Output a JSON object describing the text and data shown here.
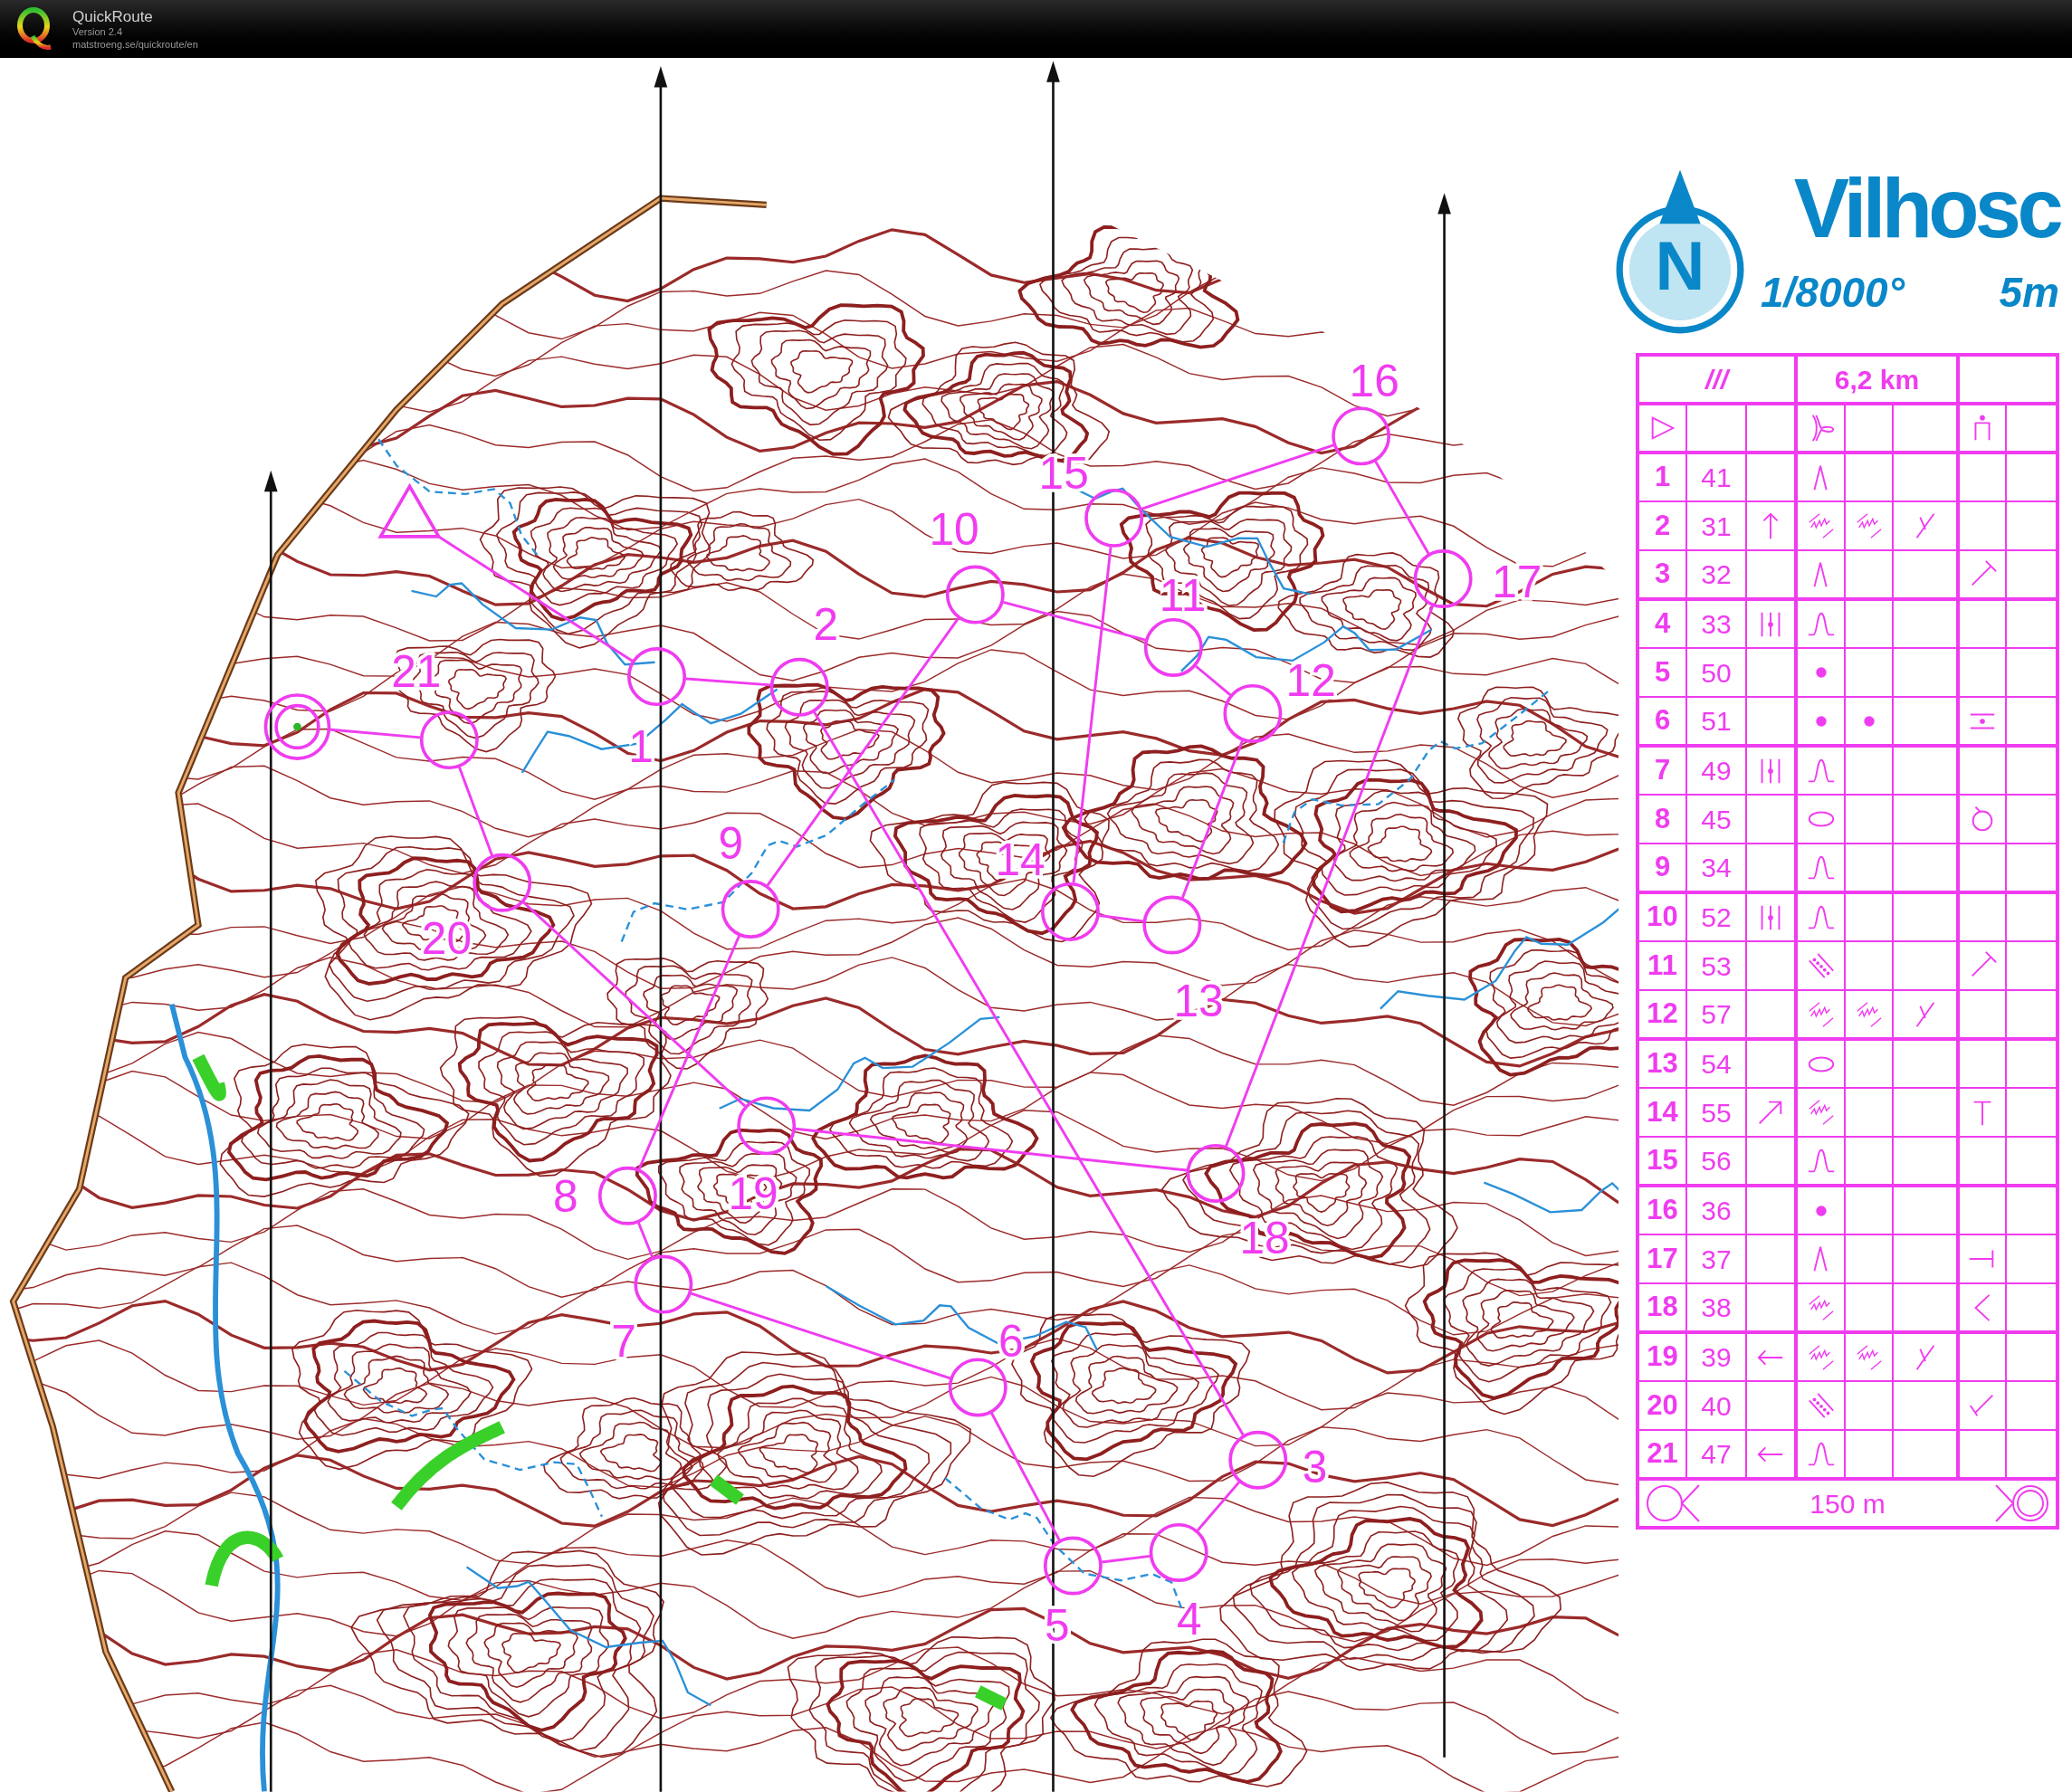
{
  "window": {
    "app_name": "QuickRoute",
    "version": "Version 2.4",
    "url": "matstroeng.se/quickroute/en"
  },
  "map": {
    "north_label": "N",
    "title": "Vilhosc",
    "scale": "1/8000°",
    "contour_interval": "5m",
    "controls": [
      {
        "label": "1"
      },
      {
        "label": "2"
      },
      {
        "label": "3"
      },
      {
        "label": "4"
      },
      {
        "label": "5"
      },
      {
        "label": "6"
      },
      {
        "label": "7"
      },
      {
        "label": "8"
      },
      {
        "label": "9"
      },
      {
        "label": "10"
      },
      {
        "label": "11"
      },
      {
        "label": "12"
      },
      {
        "label": "13"
      },
      {
        "label": "14"
      },
      {
        "label": "15"
      },
      {
        "label": "16"
      },
      {
        "label": "17"
      },
      {
        "label": "18"
      },
      {
        "label": "19"
      },
      {
        "label": "20"
      },
      {
        "label": "21"
      }
    ]
  },
  "descriptions": {
    "header": {
      "class": "///",
      "length": "6,2 km"
    },
    "start_row": [
      {
        "kind": "triangle"
      },
      {
        "kind": "blank"
      },
      {
        "kind": "blank"
      },
      {
        "kind": "fork-end"
      },
      {
        "kind": "blank"
      },
      {
        "kind": "blank"
      },
      {
        "kind": "person"
      },
      {
        "kind": "blank"
      }
    ],
    "rows": [
      {
        "number": "1",
        "code": "41",
        "cells": [
          {
            "kind": "blank"
          },
          {
            "kind": "caret"
          },
          {
            "kind": "blank"
          },
          {
            "kind": "blank"
          },
          {
            "kind": "blank"
          },
          {
            "kind": "blank"
          }
        ]
      },
      {
        "number": "2",
        "code": "31",
        "cells": [
          {
            "kind": "arrow-up"
          },
          {
            "kind": "zigzag"
          },
          {
            "kind": "zigzag"
          },
          {
            "kind": "y-junction"
          },
          {
            "kind": "blank"
          },
          {
            "kind": "blank"
          }
        ]
      },
      {
        "number": "3",
        "code": "32",
        "cells": [
          {
            "kind": "blank"
          },
          {
            "kind": "caret"
          },
          {
            "kind": "blank"
          },
          {
            "kind": "blank"
          },
          {
            "kind": "foot-tick"
          },
          {
            "kind": "blank"
          }
        ]
      },
      {
        "number": "4",
        "code": "33",
        "cells": [
          {
            "kind": "between"
          },
          {
            "kind": "hill"
          },
          {
            "kind": "blank"
          },
          {
            "kind": "blank"
          },
          {
            "kind": "blank"
          },
          {
            "kind": "blank"
          }
        ]
      },
      {
        "number": "5",
        "code": "50",
        "cells": [
          {
            "kind": "blank"
          },
          {
            "kind": "dot"
          },
          {
            "kind": "blank"
          },
          {
            "kind": "blank"
          },
          {
            "kind": "blank"
          },
          {
            "kind": "blank"
          }
        ]
      },
      {
        "number": "6",
        "code": "51",
        "cells": [
          {
            "kind": "blank"
          },
          {
            "kind": "dot"
          },
          {
            "kind": "dot"
          },
          {
            "kind": "blank"
          },
          {
            "kind": "between-lines"
          },
          {
            "kind": "blank"
          }
        ]
      },
      {
        "number": "7",
        "code": "49",
        "cells": [
          {
            "kind": "between"
          },
          {
            "kind": "hill"
          },
          {
            "kind": "blank"
          },
          {
            "kind": "blank"
          },
          {
            "kind": "blank"
          },
          {
            "kind": "blank"
          }
        ]
      },
      {
        "number": "8",
        "code": "45",
        "cells": [
          {
            "kind": "blank"
          },
          {
            "kind": "ellipse"
          },
          {
            "kind": "blank"
          },
          {
            "kind": "blank"
          },
          {
            "kind": "circle-tick"
          },
          {
            "kind": "blank"
          }
        ]
      },
      {
        "number": "9",
        "code": "34",
        "cells": [
          {
            "kind": "blank"
          },
          {
            "kind": "hill"
          },
          {
            "kind": "blank"
          },
          {
            "kind": "blank"
          },
          {
            "kind": "blank"
          },
          {
            "kind": "blank"
          }
        ]
      },
      {
        "number": "10",
        "code": "52",
        "cells": [
          {
            "kind": "between"
          },
          {
            "kind": "hill"
          },
          {
            "kind": "blank"
          },
          {
            "kind": "blank"
          },
          {
            "kind": "blank"
          },
          {
            "kind": "blank"
          }
        ]
      },
      {
        "number": "11",
        "code": "53",
        "cells": [
          {
            "kind": "blank"
          },
          {
            "kind": "dotted-band"
          },
          {
            "kind": "blank"
          },
          {
            "kind": "blank"
          },
          {
            "kind": "foot-tick"
          },
          {
            "kind": "blank"
          }
        ]
      },
      {
        "number": "12",
        "code": "57",
        "cells": [
          {
            "kind": "blank"
          },
          {
            "kind": "zigzag"
          },
          {
            "kind": "zigzag"
          },
          {
            "kind": "y-junction"
          },
          {
            "kind": "blank"
          },
          {
            "kind": "blank"
          }
        ]
      },
      {
        "number": "13",
        "code": "54",
        "cells": [
          {
            "kind": "blank"
          },
          {
            "kind": "ellipse"
          },
          {
            "kind": "blank"
          },
          {
            "kind": "blank"
          },
          {
            "kind": "blank"
          },
          {
            "kind": "blank"
          }
        ]
      },
      {
        "number": "14",
        "code": "55",
        "cells": [
          {
            "kind": "arrow-up-right"
          },
          {
            "kind": "zigzag"
          },
          {
            "kind": "blank"
          },
          {
            "kind": "blank"
          },
          {
            "kind": "t-foot"
          },
          {
            "kind": "blank"
          }
        ]
      },
      {
        "number": "15",
        "code": "56",
        "cells": [
          {
            "kind": "blank"
          },
          {
            "kind": "hill"
          },
          {
            "kind": "blank"
          },
          {
            "kind": "blank"
          },
          {
            "kind": "blank"
          },
          {
            "kind": "blank"
          }
        ]
      },
      {
        "number": "16",
        "code": "36",
        "cells": [
          {
            "kind": "blank"
          },
          {
            "kind": "dot"
          },
          {
            "kind": "blank"
          },
          {
            "kind": "blank"
          },
          {
            "kind": "blank"
          },
          {
            "kind": "blank"
          }
        ]
      },
      {
        "number": "17",
        "code": "37",
        "cells": [
          {
            "kind": "blank"
          },
          {
            "kind": "caret"
          },
          {
            "kind": "blank"
          },
          {
            "kind": "blank"
          },
          {
            "kind": "side-foot"
          },
          {
            "kind": "blank"
          }
        ]
      },
      {
        "number": "18",
        "code": "38",
        "cells": [
          {
            "kind": "blank"
          },
          {
            "kind": "zigzag"
          },
          {
            "kind": "blank"
          },
          {
            "kind": "blank"
          },
          {
            "kind": "bend"
          },
          {
            "kind": "blank"
          }
        ]
      },
      {
        "number": "19",
        "code": "39",
        "cells": [
          {
            "kind": "arrow-left"
          },
          {
            "kind": "zigzag"
          },
          {
            "kind": "zigzag"
          },
          {
            "kind": "y-junction"
          },
          {
            "kind": "blank"
          },
          {
            "kind": "blank"
          }
        ]
      },
      {
        "number": "20",
        "code": "40",
        "cells": [
          {
            "kind": "blank"
          },
          {
            "kind": "dotted-band"
          },
          {
            "kind": "blank"
          },
          {
            "kind": "blank"
          },
          {
            "kind": "check-corner"
          },
          {
            "kind": "blank"
          }
        ]
      },
      {
        "number": "21",
        "code": "47",
        "cells": [
          {
            "kind": "arrow-left"
          },
          {
            "kind": "hill"
          },
          {
            "kind": "blank"
          },
          {
            "kind": "blank"
          },
          {
            "kind": "blank"
          },
          {
            "kind": "blank"
          }
        ]
      }
    ],
    "footer": "150 m"
  }
}
